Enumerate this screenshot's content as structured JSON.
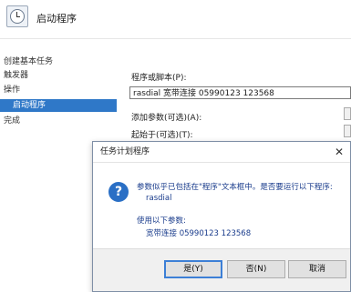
{
  "header": {
    "title": "启动程序"
  },
  "wizard": {
    "heading": "创建基本任务",
    "steps": [
      "触发器",
      "操作",
      "启动程序",
      "完成"
    ],
    "program_label": "程序或脚本(P):",
    "program_value": "rasdial 宽带连接 05990123 123568",
    "args_label": "添加参数(可选)(A):",
    "start_in_label": "起始于(可选)(T):"
  },
  "dialog": {
    "title": "任务计划程序",
    "close": "✕",
    "message_line1": "参数似乎已包括在\"程序\"文本框中。是否要运行以下程序:",
    "message_program": "rasdial",
    "params_label": "使用以下参数:",
    "params_value": "宽带连接 05990123 123568",
    "yes_label": "是(Y)",
    "no_label": "否(N)",
    "cancel_label": "取消"
  },
  "icons": {
    "header": "task-scheduler-icon",
    "question": "question-icon",
    "question_glyph": "?"
  },
  "colors": {
    "accent": "#2f78c8",
    "message_text": "#1a3c8c"
  }
}
